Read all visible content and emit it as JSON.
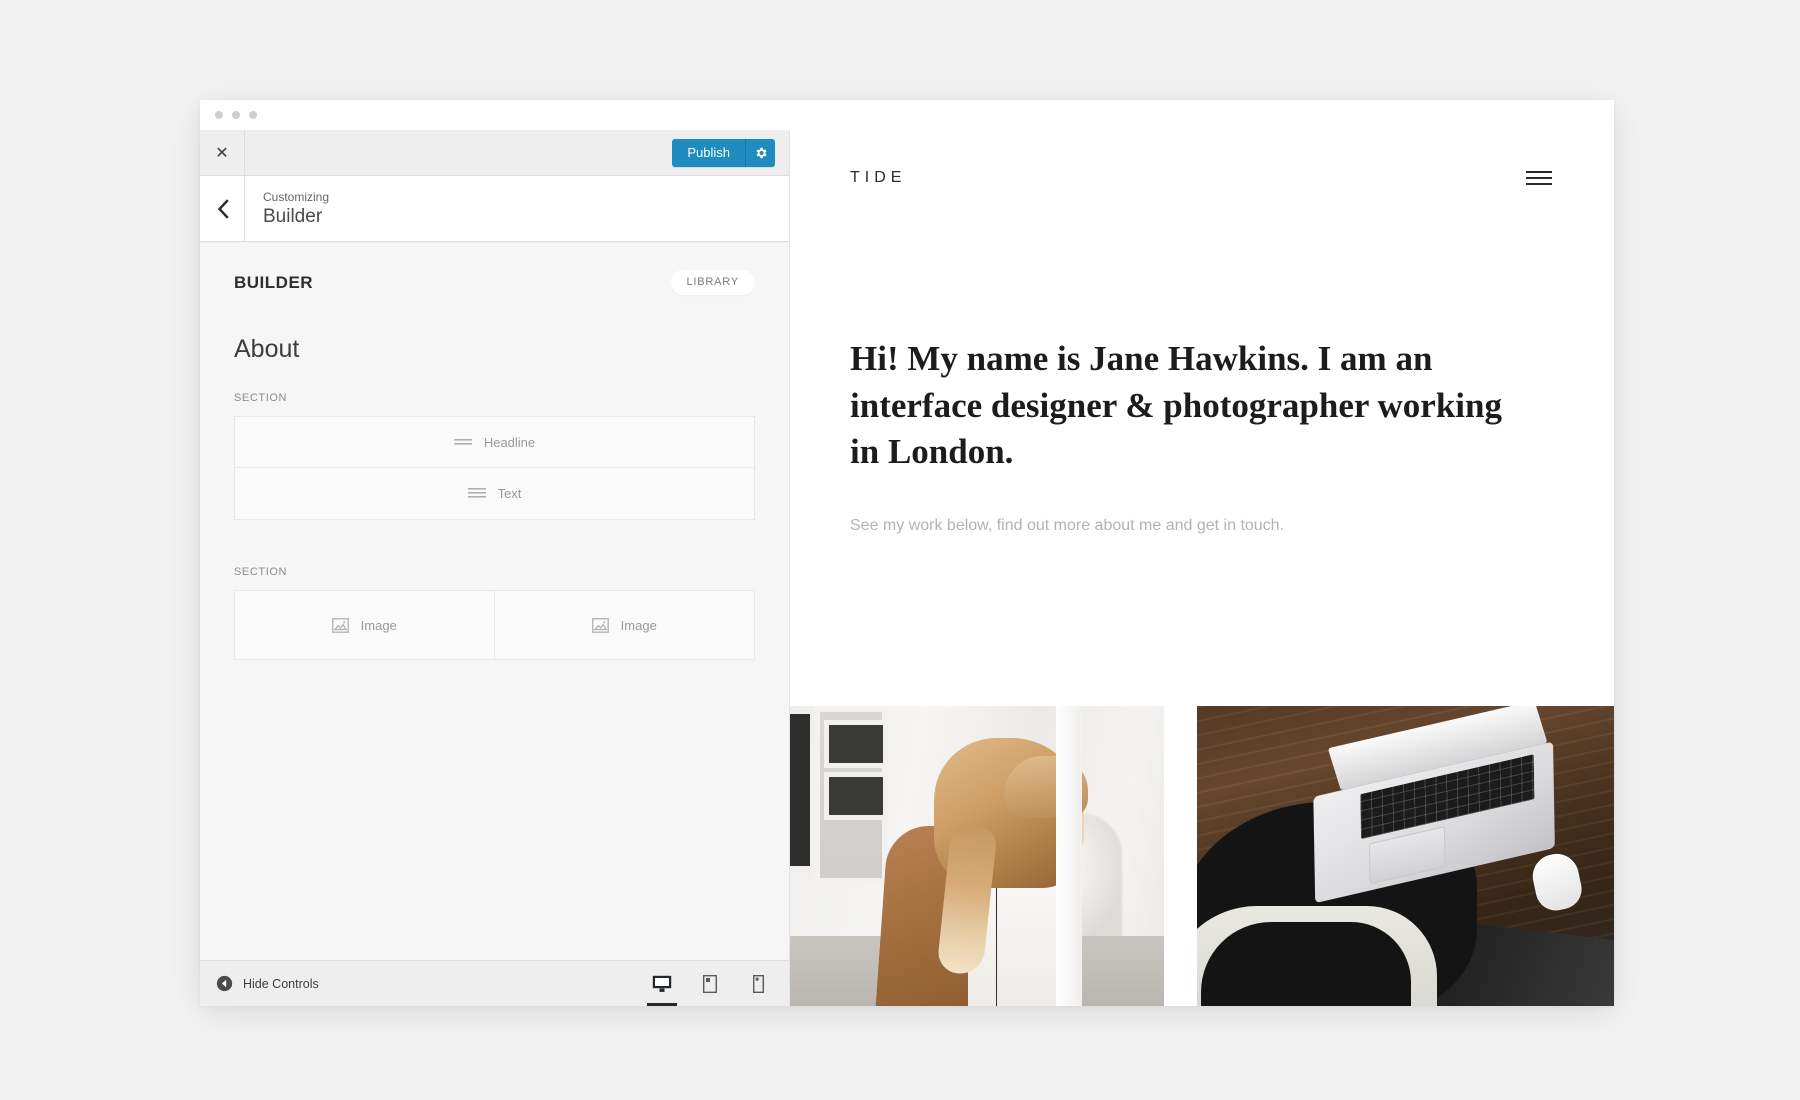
{
  "window": {
    "traffic_dots": 3
  },
  "customizer": {
    "close_icon": "close-x-icon",
    "publish_label": "Publish",
    "publish_settings_icon": "gear-icon",
    "back_icon": "chevron-left-icon",
    "breadcrumb_small": "Customizing",
    "breadcrumb_title": "Builder",
    "panel": {
      "title": "BUILDER",
      "library_label": "LIBRARY",
      "page_title": "About",
      "groups": [
        {
          "label": "SECTION",
          "layout": "rows",
          "blocks": [
            {
              "label": "Headline",
              "icon": "headline-lines-icon"
            },
            {
              "label": "Text",
              "icon": "text-lines-icon"
            }
          ]
        },
        {
          "label": "SECTION",
          "layout": "columns",
          "blocks": [
            {
              "label": "Image",
              "icon": "image-frame-icon"
            },
            {
              "label": "Image",
              "icon": "image-frame-icon"
            }
          ]
        }
      ]
    },
    "footer": {
      "hide_controls_label": "Hide Controls",
      "hide_controls_icon": "arrow-left-circle-icon",
      "devices": [
        {
          "name": "desktop",
          "icon": "desktop-icon",
          "active": true
        },
        {
          "name": "tablet",
          "icon": "tablet-icon",
          "active": false
        },
        {
          "name": "mobile",
          "icon": "mobile-icon",
          "active": false
        }
      ]
    },
    "colors": {
      "publish_blue": "#1e8cbe",
      "panel_bg": "#f6f6f6",
      "bar_bg": "#eeeeee",
      "active_device": "#23282d"
    }
  },
  "preview": {
    "logo": "TIDE",
    "menu_icon": "hamburger-menu-icon",
    "hero_title": "Hi! My name is Jane Hawkins. I am an interface designer & photographer working in London.",
    "hero_subtitle": "See my work below, find out more about me and get in touch.",
    "photos": [
      {
        "name": "photo-woman-braid",
        "alt": "Woman with blonde braided hair in tan suede jacket in a bright white interior"
      },
      {
        "name": "photo-laptop-desk",
        "alt": "Open silver laptop and white mouse on a dark wooden desk"
      }
    ]
  }
}
